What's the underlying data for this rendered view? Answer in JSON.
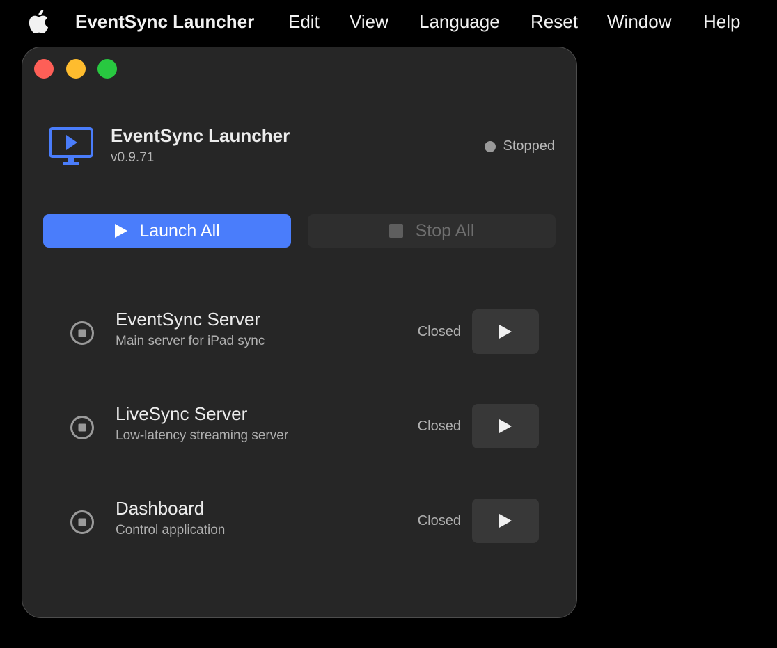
{
  "menubar": {
    "apple_icon": "apple-logo-icon",
    "app_name": "EventSync Launcher",
    "items": [
      "Edit",
      "View",
      "Language",
      "Reset",
      "Window",
      "Help"
    ]
  },
  "window": {
    "controls": [
      "close",
      "minimize",
      "maximize"
    ],
    "header": {
      "icon": "monitor-play-icon",
      "title": "EventSync Launcher",
      "version": "v0.9.71",
      "status": "Stopped"
    },
    "actions": {
      "launch_label": "Launch All",
      "stop_label": "Stop All"
    },
    "services": [
      {
        "name": "EventSync Server",
        "description": "Main server for iPad sync",
        "status": "Closed"
      },
      {
        "name": "LiveSync Server",
        "description": "Low-latency streaming server",
        "status": "Closed"
      },
      {
        "name": "Dashboard",
        "description": "Control application",
        "status": "Closed"
      }
    ]
  },
  "colors": {
    "accent": "#4a7dfb",
    "window_bg": "#262626",
    "close": "#fe5f57",
    "minimize": "#febc2e",
    "maximize": "#28c840"
  }
}
